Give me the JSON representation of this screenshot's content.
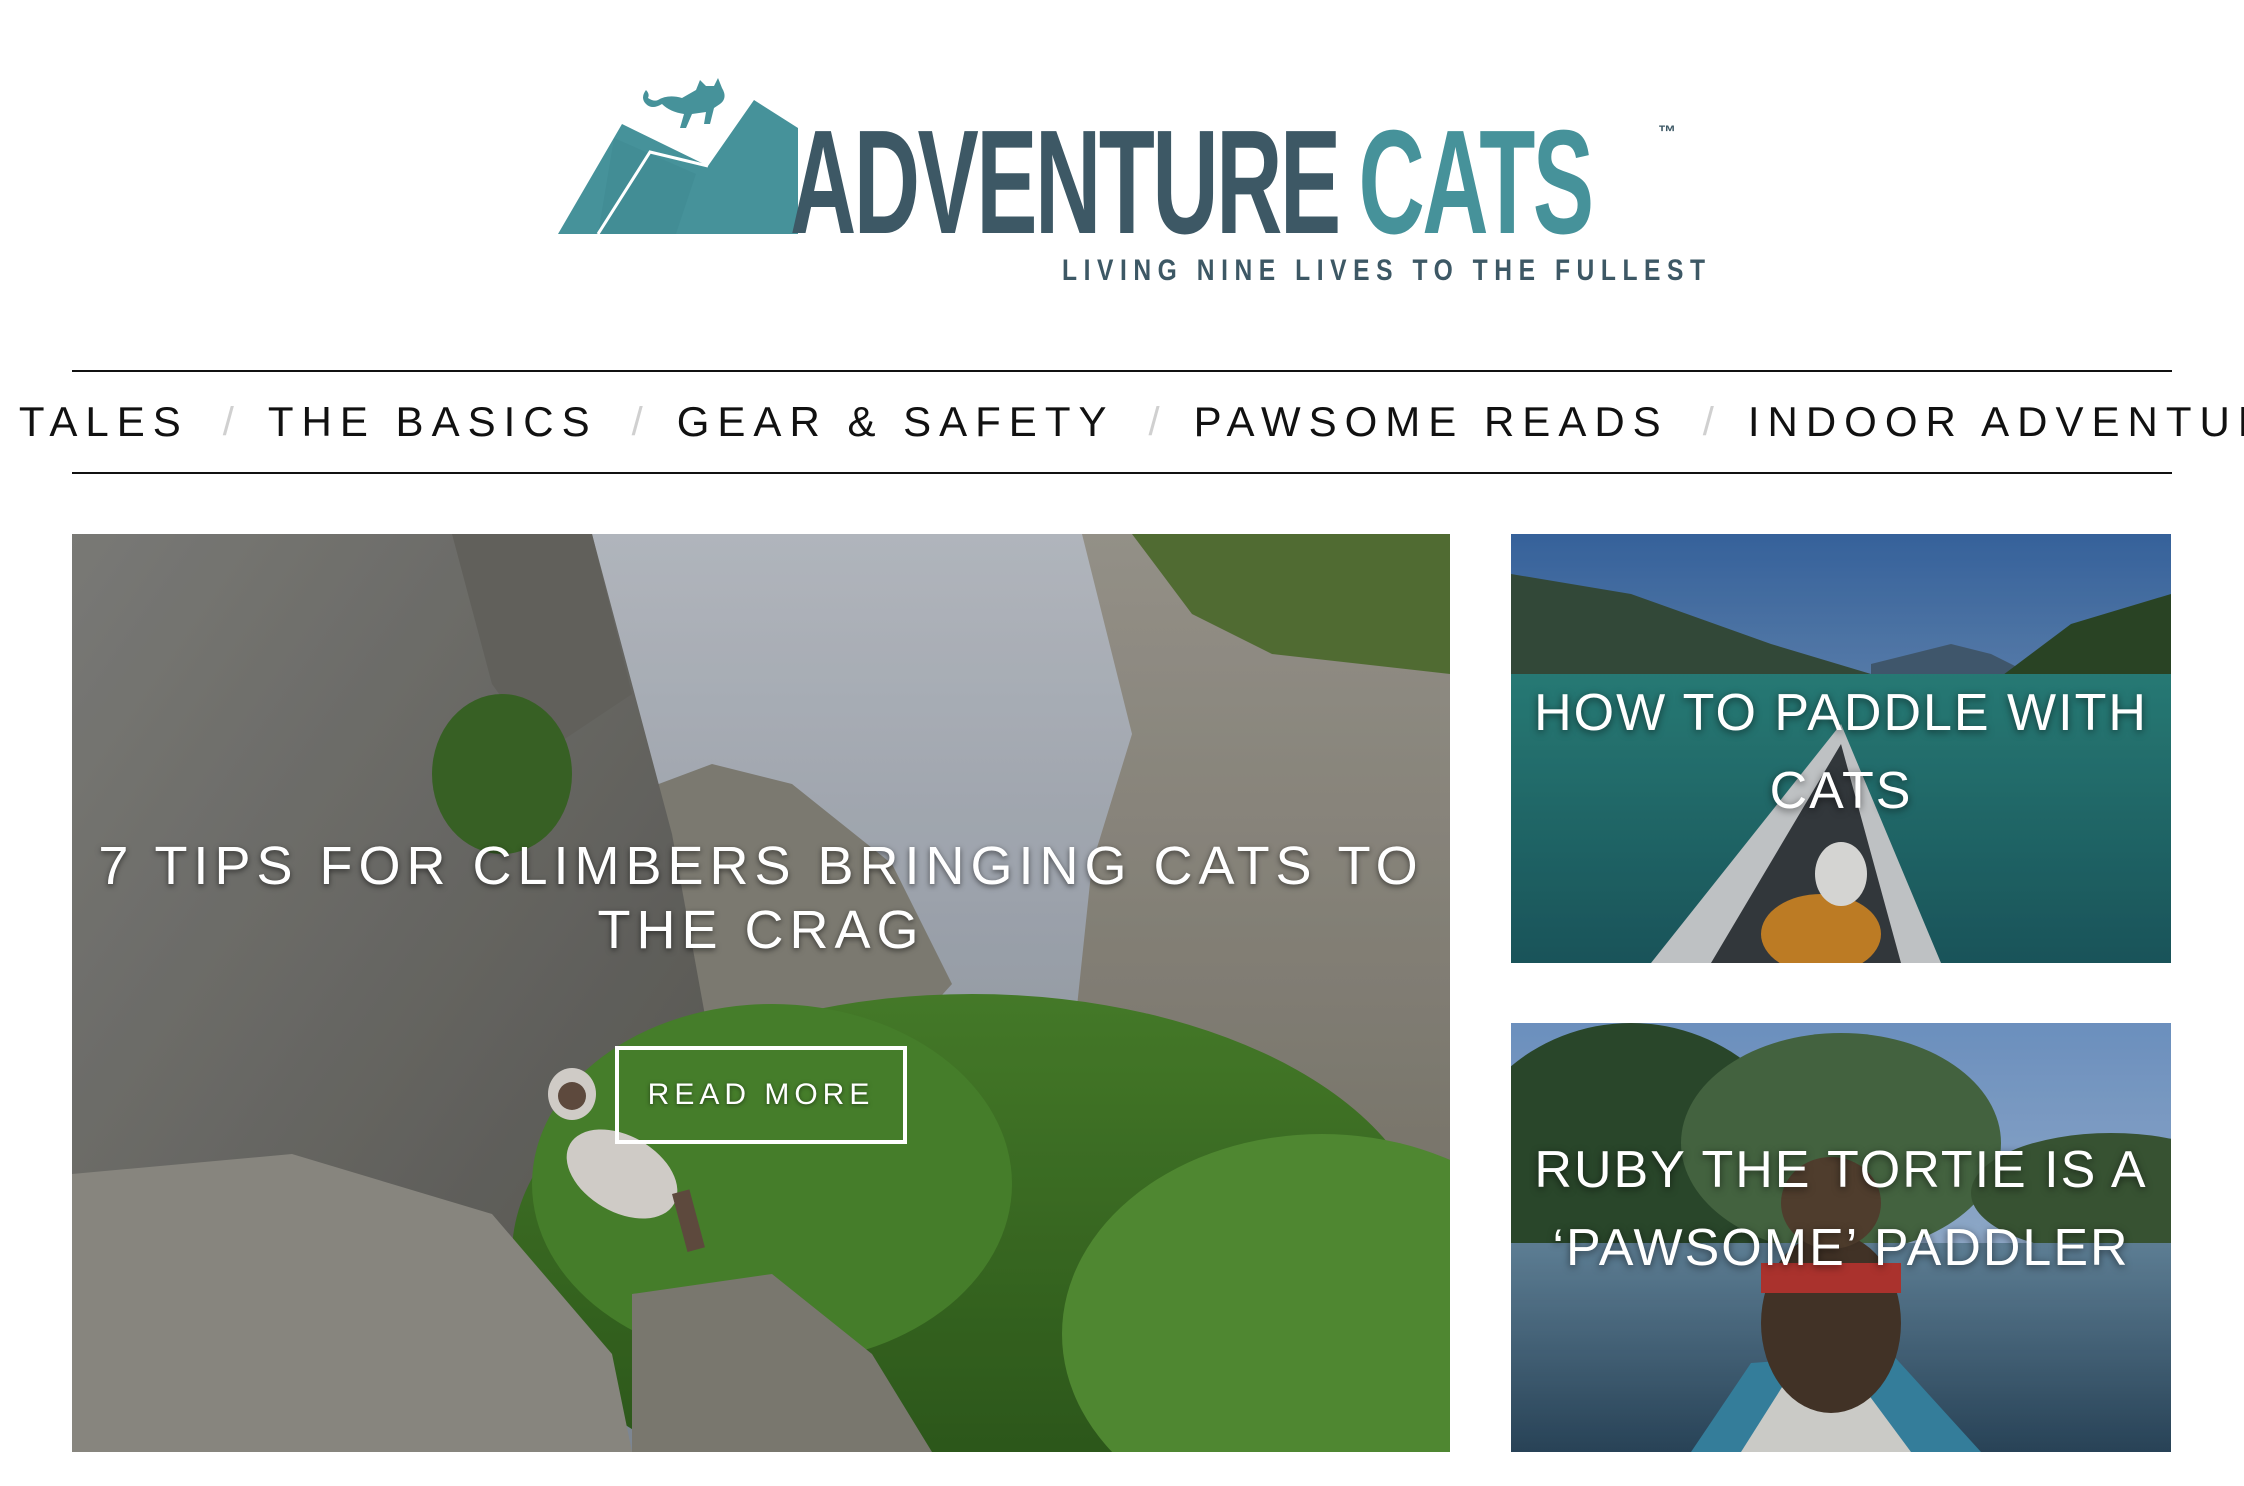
{
  "logo": {
    "word1": "ADVENTURE",
    "word2": "CATS",
    "trademark": "™",
    "tagline": "LIVING NINE LIVES TO THE FULLEST",
    "icon": "cat-on-mountain-icon",
    "colors": {
      "dark": "#3d5865",
      "teal": "#46929a"
    }
  },
  "nav": {
    "separator": "/",
    "items": [
      {
        "label": "CAT TALES"
      },
      {
        "label": "THE BASICS"
      },
      {
        "label": "GEAR & SAFETY"
      },
      {
        "label": "PAWSOME READS"
      },
      {
        "label": "INDOOR ADVENTURES"
      }
    ]
  },
  "featured": {
    "title": "7 TIPS FOR CLIMBERS BRINGING CATS TO THE CRAG",
    "button": "READ MORE"
  },
  "side_articles": [
    {
      "title": "HOW TO PADDLE WITH CATS"
    },
    {
      "title": "RUBY THE TORTIE IS A ‘PAWSOME’ PADDLER"
    }
  ]
}
